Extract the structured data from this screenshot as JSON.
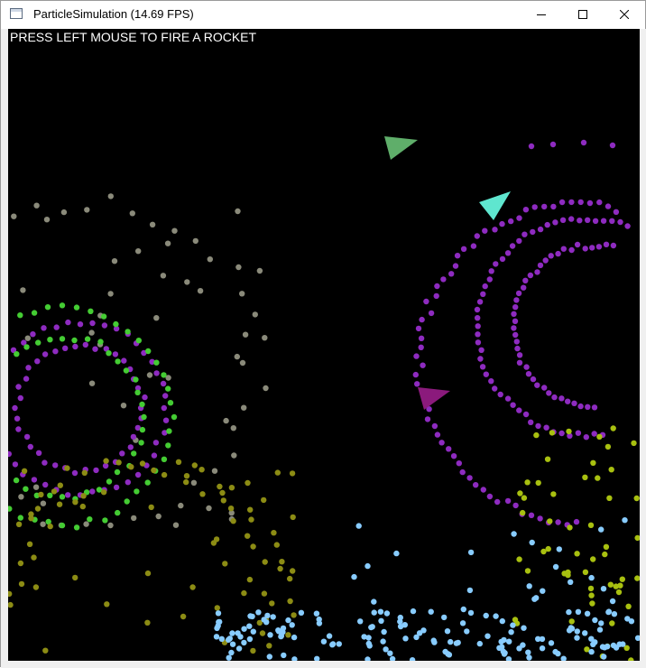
{
  "window": {
    "title": "ParticleSimulation (14.69 FPS)",
    "app_icon": "window-app-icon",
    "controls": {
      "minimize_icon": "minimize-icon",
      "maximize_icon": "maximize-icon",
      "close_icon": "close-icon"
    }
  },
  "simulation": {
    "instruction": "PRESS LEFT MOUSE TO FIRE A ROCKET",
    "background_color": "#000000",
    "hud_text_color": "#ffffff",
    "particle_colors": {
      "purple": "#8e2bc0",
      "green": "#44cc33",
      "gray": "#8a8a7a",
      "olive": "#8c8c14",
      "yellow_green": "#a8c010",
      "light_blue": "#88ccff"
    },
    "rocket_colors": {
      "green_rocket": "#5fae6a",
      "cyan_rocket": "#5fe6cf",
      "magenta_rocket": "#8b1a7c"
    }
  }
}
